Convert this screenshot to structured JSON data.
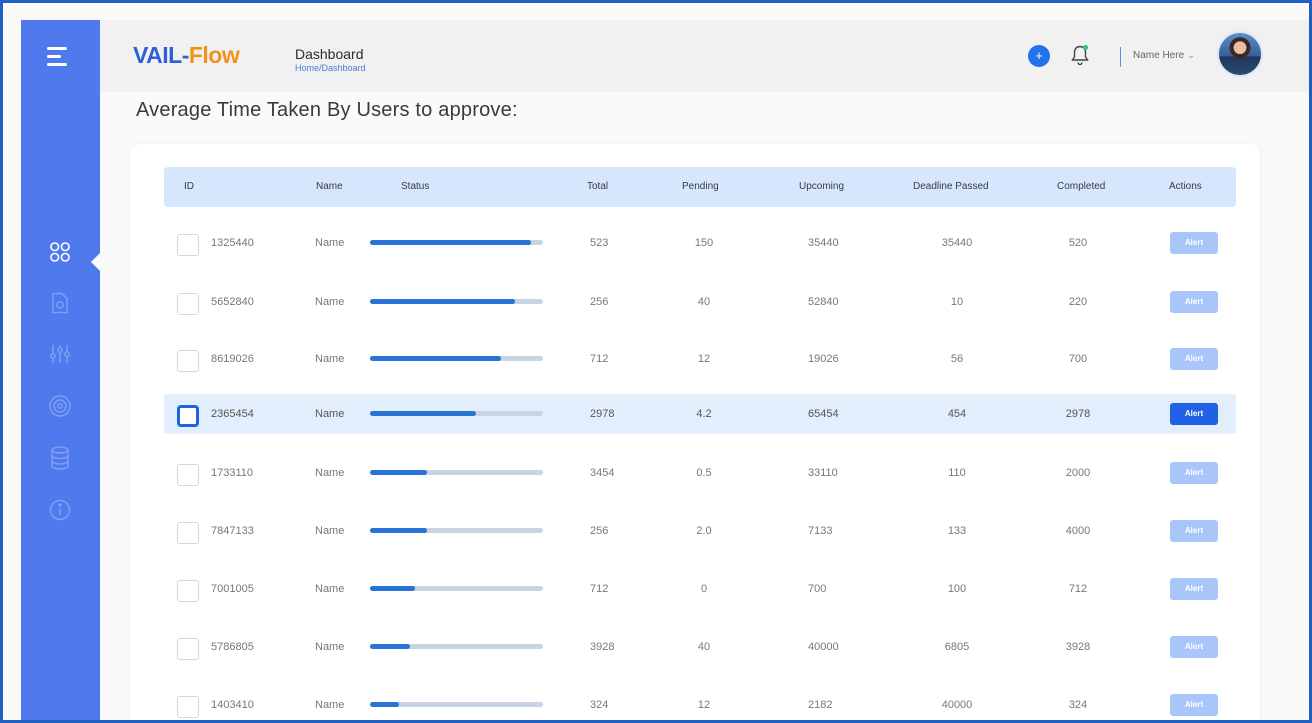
{
  "app": {
    "logo_part1": "VAIL",
    "logo_dash": "-",
    "logo_part2": "Flow"
  },
  "header": {
    "title": "Dashboard",
    "breadcrumb": "Home/Dashboard",
    "add_icon": "plus-icon",
    "plus_symbol": "+",
    "notification_icon": "bell-icon",
    "user_name": "Name Here",
    "user_caret": "⌄"
  },
  "sidebar": {
    "menu_icon": "hamburger-menu-icon",
    "items": [
      {
        "icon": "grid-icon",
        "active": true
      },
      {
        "icon": "document-icon",
        "active": false
      },
      {
        "icon": "sliders-icon",
        "active": false
      },
      {
        "icon": "target-icon",
        "active": false
      },
      {
        "icon": "database-icon",
        "active": false
      },
      {
        "icon": "info-icon",
        "active": false
      }
    ]
  },
  "main": {
    "heading": "Average Time Taken By Users to approve:",
    "columns": [
      "ID",
      "Name",
      "Status",
      "Total",
      "Pending",
      "Upcoming",
      "Deadline Passed",
      "Completed",
      "Actions"
    ],
    "rows": [
      {
        "id": "1325440",
        "name": "Name",
        "status": 0.93,
        "total": "523",
        "pending": "150",
        "upcoming": "35440",
        "deadline": "35440",
        "completed": "520",
        "action": "Alert",
        "selected": false
      },
      {
        "id": "5652840",
        "name": "Name",
        "status": 0.84,
        "total": "256",
        "pending": "40",
        "upcoming": "52840",
        "deadline": "10",
        "completed": "220",
        "action": "Alert",
        "selected": false
      },
      {
        "id": "8619026",
        "name": "Name",
        "status": 0.76,
        "total": "712",
        "pending": "12",
        "upcoming": "19026",
        "deadline": "56",
        "completed": "700",
        "action": "Alert",
        "selected": false
      },
      {
        "id": "2365454",
        "name": "Name",
        "status": 0.61,
        "total": "2978",
        "pending": "4.2",
        "upcoming": "65454",
        "deadline": "454",
        "completed": "2978",
        "action": "Alert",
        "selected": true
      },
      {
        "id": "1733110",
        "name": "Name",
        "status": 0.33,
        "total": "3454",
        "pending": "0.5",
        "upcoming": "33110",
        "deadline": "110",
        "completed": "2000",
        "action": "Alert",
        "selected": false
      },
      {
        "id": "7847133",
        "name": "Name",
        "status": 0.33,
        "total": "256",
        "pending": "2.0",
        "upcoming": "7133",
        "deadline": "133",
        "completed": "4000",
        "action": "Alert",
        "selected": false
      },
      {
        "id": "7001005",
        "name": "Name",
        "status": 0.26,
        "total": "712",
        "pending": "0",
        "upcoming": "700",
        "deadline": "100",
        "completed": "712",
        "action": "Alert",
        "selected": false
      },
      {
        "id": "5786805",
        "name": "Name",
        "status": 0.23,
        "total": "3928",
        "pending": "40",
        "upcoming": "40000",
        "deadline": "6805",
        "completed": "3928",
        "action": "Alert",
        "selected": false
      },
      {
        "id": "1403410",
        "name": "Name",
        "status": 0.17,
        "total": "324",
        "pending": "12",
        "upcoming": "2182",
        "deadline": "40000",
        "completed": "324",
        "action": "Alert",
        "selected": false
      }
    ]
  },
  "colors": {
    "sidebar": "#4f79ec",
    "accent": "#1f62e6",
    "logo_blue": "#2f5fd7",
    "logo_orange": "#f0921e",
    "table_header": "#d6e6fd",
    "selected_row": "#e3eefd",
    "bar_fill": "#2a73d6",
    "bar_track": "#c8d3e3"
  }
}
